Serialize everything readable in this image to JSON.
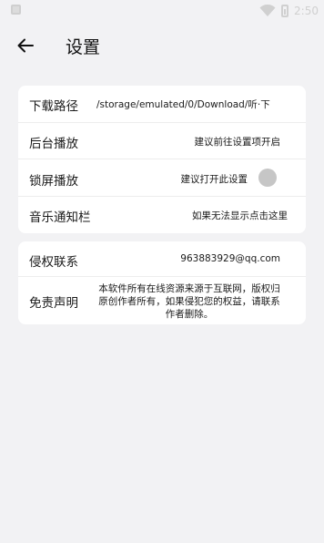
{
  "status_bar": {
    "time": "2:50"
  },
  "header": {
    "title": "设置"
  },
  "settings": {
    "download_path": {
      "label": "下载路径",
      "value": "/storage/emulated/0/Download/听·下"
    },
    "background_play": {
      "label": "后台播放",
      "value": "建议前往设置项开启"
    },
    "lockscreen_play": {
      "label": "锁屏播放",
      "value": "建议打开此设置",
      "enabled": false
    },
    "music_notification": {
      "label": "音乐通知栏",
      "value": "如果无法显示点击这里"
    }
  },
  "about": {
    "infringement": {
      "label": "侵权联系",
      "value": "963883929@qq.com"
    },
    "disclaimer": {
      "label": "免责声明",
      "value": "本软件所有在线资源来源于互联网，版权归原创作者所有，如果侵犯您的权益，请联系作者删除。"
    }
  },
  "colors": {
    "background": "#f2f2f4",
    "card": "#ffffff",
    "toggle_off": "#c6c6c6"
  }
}
